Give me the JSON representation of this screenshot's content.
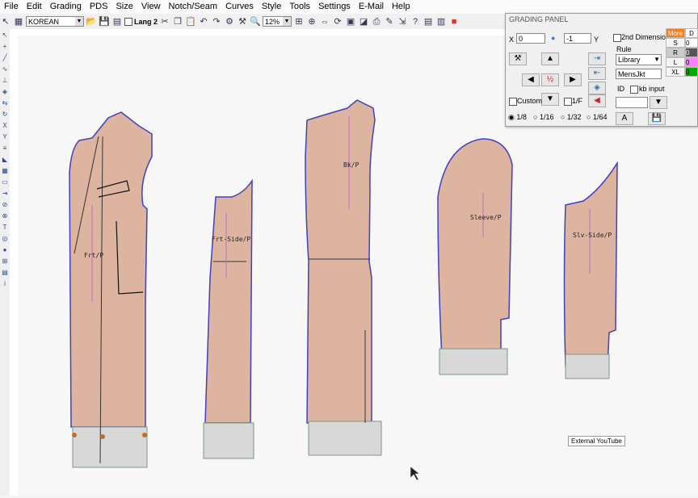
{
  "menu": [
    "File",
    "Edit",
    "Grading",
    "PDS",
    "Size",
    "View",
    "Notch/Seam",
    "Curves",
    "Style",
    "Tools",
    "Settings",
    "E-Mail",
    "Help"
  ],
  "toolbar": {
    "language": "KOREAN",
    "lang2_label": "Lang 2",
    "zoom": "12%"
  },
  "grading_panel": {
    "title": "GRADING PANEL",
    "x_label": "X",
    "x_value": "0",
    "y_value": "-1",
    "y_label": "Y",
    "second_dimension_label": "2nd Dimension",
    "rule_label": "Rule",
    "rule_source": "Library",
    "rule_name": "MensJkt",
    "id_label": "ID",
    "kb_input_label": "kb input",
    "custom_label": "Custom",
    "fraction_label": "1/F",
    "fractions": [
      "1/8",
      "1/16",
      "1/32",
      "1/64"
    ],
    "center_fraction": "½",
    "a_button": "A",
    "more_label": "More"
  },
  "size_table": {
    "header_col": "D",
    "sizes": [
      "S",
      "R",
      "L",
      "XL"
    ],
    "values": [
      "0",
      "0",
      "0",
      "0"
    ],
    "swatch_colors": [
      "#ffffff",
      "#555555",
      "#ff80ff",
      "#00aa00"
    ]
  },
  "pieces": [
    "Frt/P",
    "Frt-Side/P",
    "Bk/P",
    "Sleeve/P",
    "Slv-Side/P"
  ],
  "tooltip": "External YouTube",
  "colors": {
    "fabric": "#dcb4a0",
    "outline": "#4040c0",
    "grid": "#2255cc"
  }
}
